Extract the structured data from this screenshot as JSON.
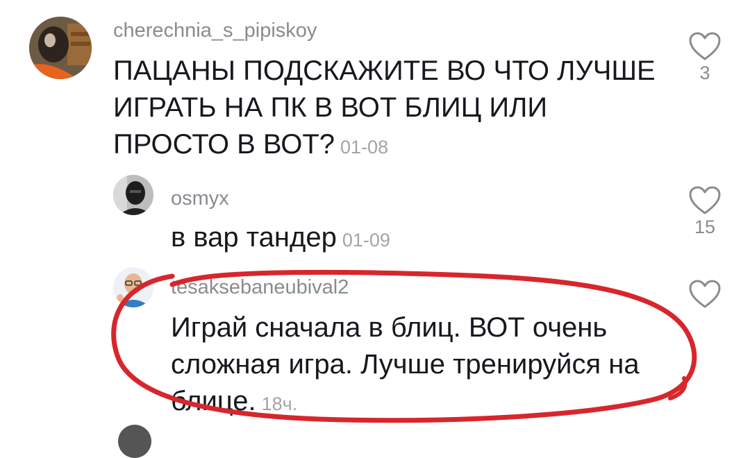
{
  "comments": [
    {
      "username": "cherechnia_s_pipiskoy",
      "text": "ПАЦАНЫ ПОДСКАЖИТЕ ВО ЧТО ЛУЧШЕ ИГРАТЬ НА ПК В ВОТ БЛИЦ ИЛИ ПРОСТО В ВОТ?",
      "time": "01-08",
      "likes": "3",
      "avatar_icon": "cat-photo-avatar"
    },
    {
      "username": "osmyx",
      "text": "в вар тандер",
      "time": "01-09",
      "likes": "15",
      "avatar_icon": "masked-person-avatar"
    },
    {
      "username": "tesaksebaneubival2",
      "text": "Играй сначала в блиц. ВОТ очень сложная игра. Лучше тренируйся на блице.",
      "time": "18ч.",
      "likes": "",
      "avatar_icon": "man-with-glasses-avatar"
    }
  ],
  "colors": {
    "username": "#8a8b91",
    "text": "#16181e",
    "time": "#a3a4a9",
    "annotation": "#d7262c"
  }
}
